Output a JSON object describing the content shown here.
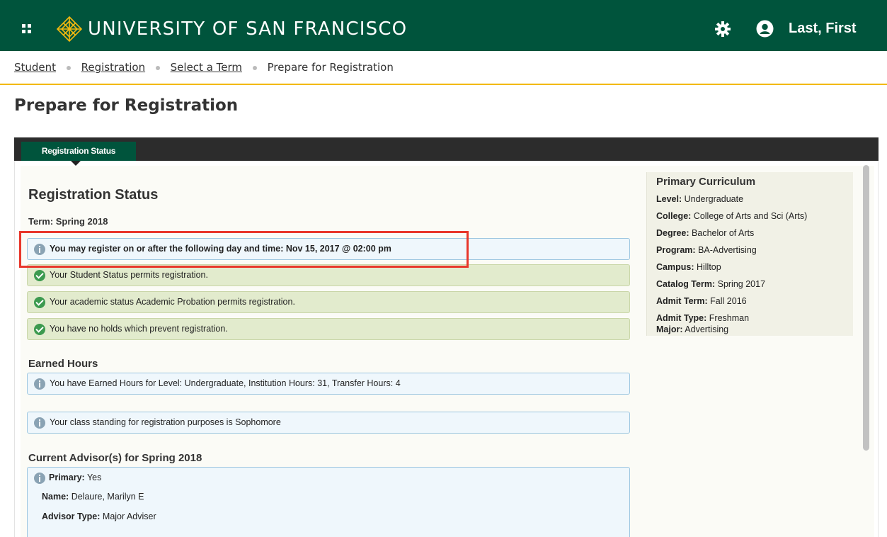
{
  "header": {
    "title": "UNIVERSITY OF SAN FRANCISCO",
    "user_name": "Last, First",
    "colors": {
      "bar": "#00543c",
      "gold": "#f2b90f"
    }
  },
  "breadcrumb": {
    "items": [
      "Student",
      "Registration",
      "Select a Term"
    ],
    "current": "Prepare for Registration"
  },
  "page_title": "Prepare for Registration",
  "tabs": [
    {
      "label": "Registration Status",
      "active": true
    }
  ],
  "registration_status": {
    "heading": "Registration Status",
    "term": "Term: Spring 2018",
    "time_ticket": "You may register on or after the following day and time: Nov 15, 2017 @ 02:00 pm",
    "checks": [
      "Your Student Status permits registration.",
      "Your academic status Academic Probation permits registration.",
      "You have no holds which prevent registration."
    ]
  },
  "earned_hours": {
    "heading": "Earned Hours",
    "message": "You have Earned Hours for Level: Undergraduate, Institution Hours: 31, Transfer Hours: 4",
    "class_standing": "Your class standing for registration purposes is Sophomore"
  },
  "advisors": {
    "heading": "Current Advisor(s) for Spring 2018",
    "fields": [
      {
        "label": "Primary:",
        "value": "Yes"
      },
      {
        "label": "Name:",
        "value": "Delaure, Marilyn E"
      },
      {
        "label": "Advisor Type:",
        "value": "Major Adviser"
      }
    ]
  },
  "primary_curriculum": {
    "heading": "Primary Curriculum",
    "fields": [
      {
        "label": "Level:",
        "value": "Undergraduate"
      },
      {
        "label": "College:",
        "value": "College of Arts and Sci (Arts)"
      },
      {
        "label": "Degree:",
        "value": "Bachelor of Arts"
      },
      {
        "label": "Program:",
        "value": "BA-Advertising"
      },
      {
        "label": "Campus:",
        "value": "Hilltop"
      },
      {
        "label": "Catalog Term:",
        "value": "Spring 2017"
      },
      {
        "label": "Admit Term:",
        "value": "Fall 2016"
      },
      {
        "label": "Admit Type:",
        "value": "Freshman"
      },
      {
        "label": "Major:",
        "value": "Advertising"
      }
    ]
  },
  "icons": {
    "apps": "apps-grid-icon",
    "logo": "usf-logo-icon",
    "settings": "gear-icon",
    "user": "user-avatar-icon",
    "info": "info-icon",
    "check": "check-circle-icon"
  }
}
